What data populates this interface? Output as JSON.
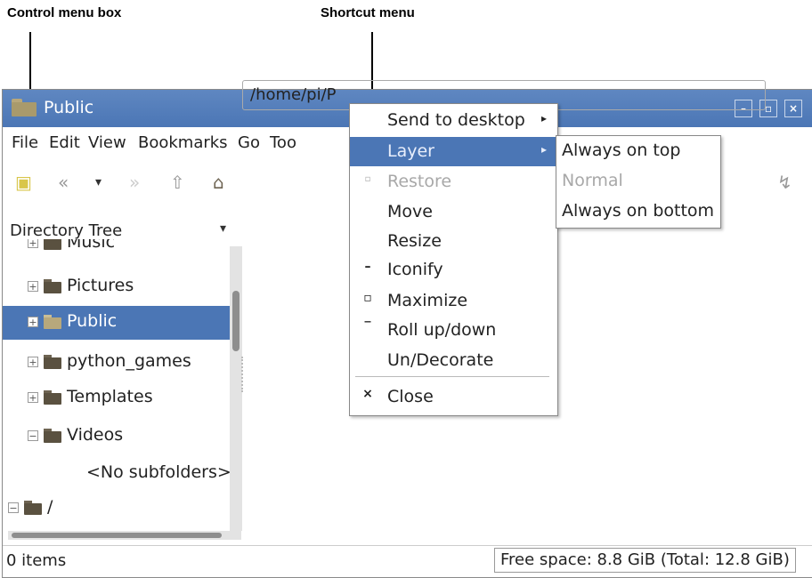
{
  "callouts": {
    "control_menu_box": "Control menu box",
    "shortcut_menu": "Shortcut menu"
  },
  "window": {
    "title": "Public",
    "buttons": {
      "minimize": "–",
      "maximize": "▫",
      "close": "×"
    }
  },
  "menubar": [
    "File",
    "Edit",
    "View",
    "Bookmarks",
    "Go",
    "Too"
  ],
  "toolbar": {
    "address": "/home/pi/P",
    "icons": [
      "new-tab-icon",
      "back-icon",
      "history-dropdown-icon",
      "forward-icon",
      "up-icon",
      "home-icon",
      "go-icon"
    ]
  },
  "sidebar": {
    "title": "Directory Tree",
    "tree": [
      {
        "label": "Music",
        "expander": "+"
      },
      {
        "label": "Pictures",
        "expander": "+"
      },
      {
        "label": "Public",
        "expander": "+",
        "selected": true
      },
      {
        "label": "python_games",
        "expander": "+"
      },
      {
        "label": "Templates",
        "expander": "+"
      },
      {
        "label": "Videos",
        "expander": "−"
      },
      {
        "label": "<No subfolders>"
      },
      {
        "label": "/",
        "expander": "−"
      }
    ]
  },
  "status": {
    "items": "0 items",
    "free_space": "Free space: 8.8 GiB (Total: 12.8 GiB)"
  },
  "context_menu": [
    {
      "label": "Send to desktop",
      "icon": "",
      "arrow": "▸"
    },
    {
      "label": "Layer",
      "icon": "",
      "arrow": "▸",
      "highlighted": true
    },
    {
      "label": "Restore",
      "icon": "▫",
      "disabled": true
    },
    {
      "label": "Move",
      "icon": ""
    },
    {
      "label": "Resize",
      "icon": ""
    },
    {
      "label": "Iconify",
      "icon": "–"
    },
    {
      "label": "Maximize",
      "icon": "▫"
    },
    {
      "label": "Roll up/down",
      "icon": "‾"
    },
    {
      "label": "Un/Decorate",
      "icon": ""
    },
    {
      "label": "Close",
      "icon": "×"
    }
  ],
  "layer_submenu": [
    {
      "label": "Always on top"
    },
    {
      "label": "Normal",
      "disabled": true
    },
    {
      "label": "Always on bottom"
    }
  ],
  "colors": {
    "accent": "#4b76b5",
    "disabled_text": "#a8a8a8"
  }
}
